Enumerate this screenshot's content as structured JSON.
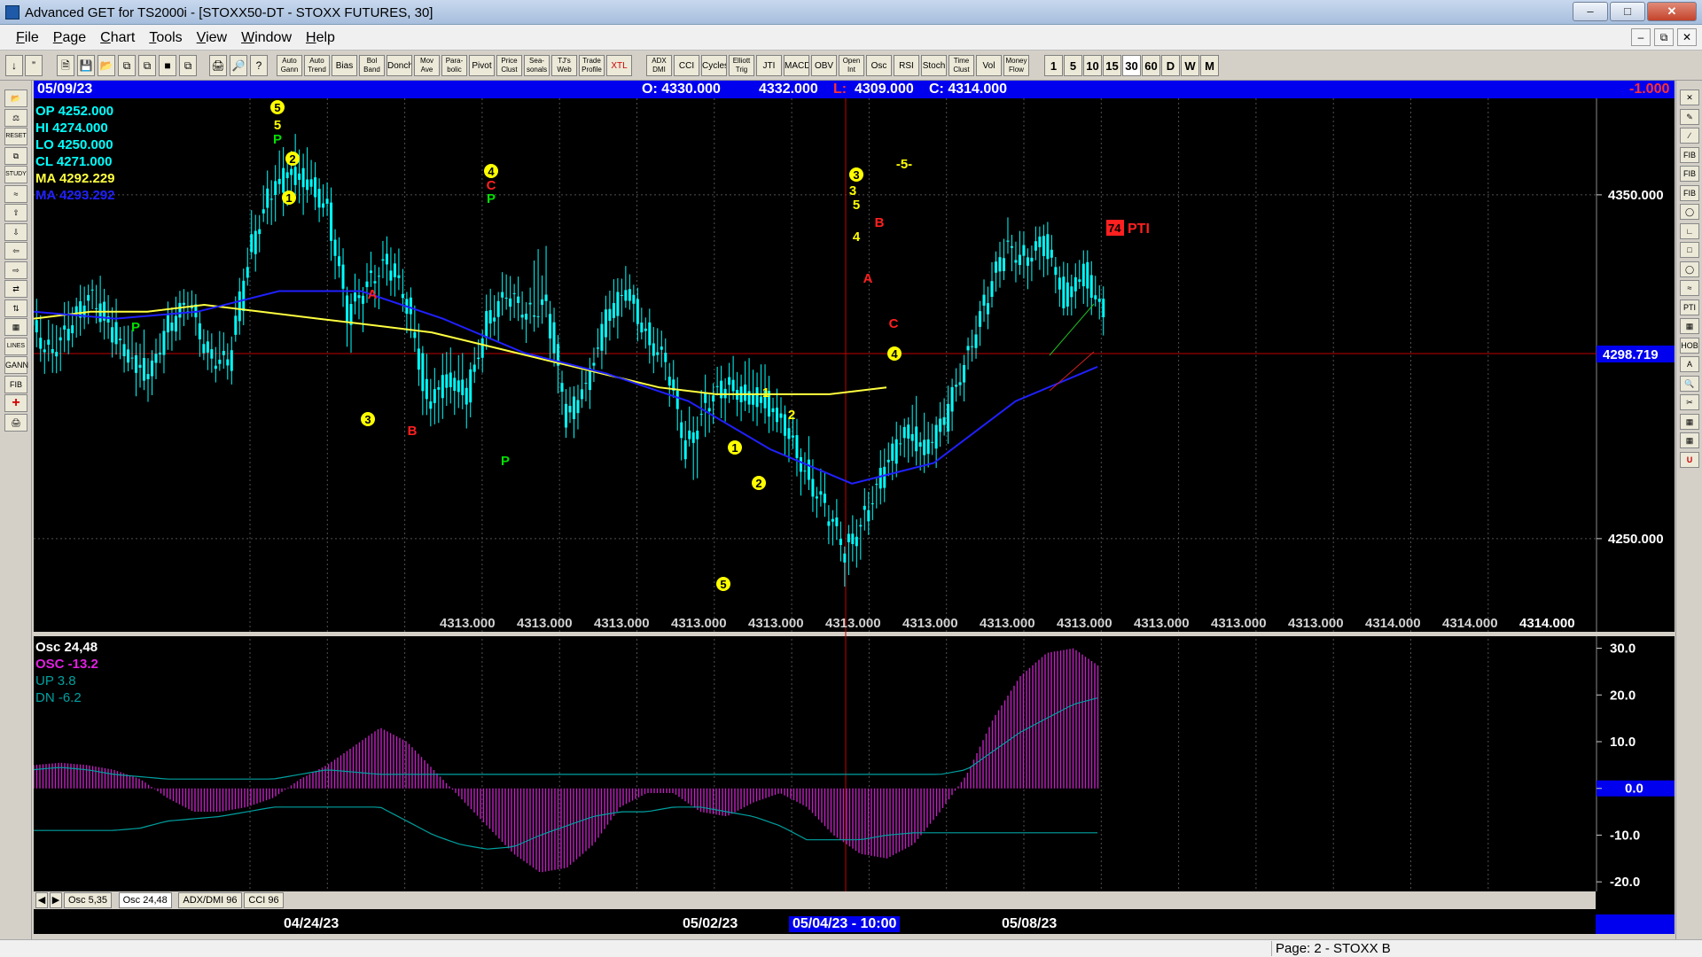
{
  "window": {
    "title": "Advanced GET for TS2000i - [STOXX50-DT - STOXX FUTURES, 30]"
  },
  "menu": [
    "File",
    "Page",
    "Chart",
    "Tools",
    "View",
    "Window",
    "Help"
  ],
  "toolbar": {
    "studies": [
      "Auto\nGann",
      "Auto\nTrend",
      "Bias",
      "Bol\nBand",
      "Donch",
      "Mov\nAve",
      "Para-\nbolic",
      "Pivot",
      "Price\nClust",
      "Sea-\nsonals",
      "TJ's\nWeb",
      "Trade\nProfile",
      "XTL",
      "ADX\nDMI",
      "CCI",
      "Cycles",
      "Elliott\nTrig",
      "JTI",
      "MACD",
      "OBV",
      "Open\nInt",
      "Osc",
      "RSI",
      "Stoch",
      "Time\nClust",
      "Vol",
      "Money\nFlow"
    ],
    "intervals": [
      "1",
      "5",
      "10",
      "15",
      "30",
      "60",
      "D",
      "W",
      "M"
    ],
    "active_interval": "30"
  },
  "infobar": {
    "date": "05/09/23",
    "open": "O: 4330.000",
    "high": "4332.000",
    "low_prefix": "L:",
    "low": "4309.000",
    "close": "C: 4314.000",
    "change": "-1.000"
  },
  "legend": {
    "op": "OP  4252.000",
    "hi": "HI   4274.000",
    "lo": "LO  4250.000",
    "cl": "CL  4271.000",
    "ma1": "MA  4292.229",
    "ma2": "MA  4293.292"
  },
  "osc_legend": {
    "title": "Osc 24,48",
    "osc": "OSC -13.2",
    "up": "UP   3.8",
    "dn": "DN   -6.2"
  },
  "pti": {
    "value": "74",
    "label": "PTI"
  },
  "price_line_label": "4298.719",
  "bottom_values": [
    "4313.000",
    "4313.000",
    "4313.000",
    "4313.000",
    "4313.000",
    "4313.000",
    "4313.000",
    "4313.000",
    "4313.000",
    "4313.000",
    "4313.000",
    "4313.000",
    "4314.000",
    "4314.000",
    "4314.000"
  ],
  "tabs": [
    "Osc 5,35",
    "Osc 24,48",
    "ADX/DMI 96",
    "CCI 96"
  ],
  "active_tab": "Osc 24,48",
  "dates": {
    "d1": "04/24/23",
    "d2": "05/02/23",
    "cursor": "05/04/23 - 10:00",
    "d3": "05/08/23"
  },
  "status": {
    "page": "Page: 2 - STOXX B"
  },
  "colors": {
    "candle": "#00ffff",
    "ma_yellow": "#ffff40",
    "ma_blue": "#2020ff",
    "osc_hist": "#c020c0",
    "osc_line": "#00a0a0",
    "wave_yellow": "#ffff00",
    "label_red": "#ff2020",
    "label_green": "#00e000",
    "cursor_line": "#c00000"
  },
  "chart_data": [
    {
      "type": "candlestick",
      "symbol": "STOXX50-DT - STOXX FUTURES",
      "interval": "30",
      "y_ticks": [
        "4350.000",
        "4250.000"
      ],
      "ylim": [
        4226,
        4376
      ],
      "ohlc_samples": [
        {
          "o": 4312,
          "h": 4318,
          "l": 4300,
          "c": 4305
        },
        {
          "o": 4305,
          "h": 4318,
          "l": 4296,
          "c": 4310
        },
        {
          "o": 4310,
          "h": 4326,
          "l": 4304,
          "c": 4322
        },
        {
          "o": 4322,
          "h": 4330,
          "l": 4308,
          "c": 4312
        },
        {
          "o": 4312,
          "h": 4318,
          "l": 4298,
          "c": 4302
        },
        {
          "o": 4302,
          "h": 4310,
          "l": 4292,
          "c": 4298
        },
        {
          "o": 4298,
          "h": 4316,
          "l": 4294,
          "c": 4312
        },
        {
          "o": 4312,
          "h": 4322,
          "l": 4306,
          "c": 4318
        },
        {
          "o": 4318,
          "h": 4320,
          "l": 4300,
          "c": 4304
        },
        {
          "o": 4304,
          "h": 4312,
          "l": 4298,
          "c": 4300
        },
        {
          "o": 4300,
          "h": 4336,
          "l": 4298,
          "c": 4332
        },
        {
          "o": 4332,
          "h": 4356,
          "l": 4328,
          "c": 4350
        },
        {
          "o": 4350,
          "h": 4364,
          "l": 4342,
          "c": 4356
        },
        {
          "o": 4356,
          "h": 4366,
          "l": 4346,
          "c": 4354
        },
        {
          "o": 4354,
          "h": 4358,
          "l": 4344,
          "c": 4346
        },
        {
          "o": 4346,
          "h": 4350,
          "l": 4308,
          "c": 4314
        },
        {
          "o": 4314,
          "h": 4330,
          "l": 4306,
          "c": 4326
        },
        {
          "o": 4326,
          "h": 4334,
          "l": 4316,
          "c": 4330
        },
        {
          "o": 4330,
          "h": 4338,
          "l": 4314,
          "c": 4318
        },
        {
          "o": 4318,
          "h": 4326,
          "l": 4284,
          "c": 4290
        },
        {
          "o": 4290,
          "h": 4302,
          "l": 4280,
          "c": 4296
        },
        {
          "o": 4296,
          "h": 4304,
          "l": 4286,
          "c": 4292
        },
        {
          "o": 4292,
          "h": 4318,
          "l": 4290,
          "c": 4314
        },
        {
          "o": 4314,
          "h": 4326,
          "l": 4308,
          "c": 4320
        },
        {
          "o": 4320,
          "h": 4326,
          "l": 4310,
          "c": 4316
        },
        {
          "o": 4316,
          "h": 4344,
          "l": 4312,
          "c": 4318
        },
        {
          "o": 4318,
          "h": 4320,
          "l": 4276,
          "c": 4284
        },
        {
          "o": 4284,
          "h": 4300,
          "l": 4280,
          "c": 4296
        },
        {
          "o": 4296,
          "h": 4318,
          "l": 4292,
          "c": 4314
        },
        {
          "o": 4314,
          "h": 4328,
          "l": 4308,
          "c": 4322
        },
        {
          "o": 4322,
          "h": 4324,
          "l": 4306,
          "c": 4310
        },
        {
          "o": 4310,
          "h": 4316,
          "l": 4296,
          "c": 4300
        },
        {
          "o": 4300,
          "h": 4304,
          "l": 4270,
          "c": 4276
        },
        {
          "o": 4276,
          "h": 4296,
          "l": 4262,
          "c": 4290
        },
        {
          "o": 4290,
          "h": 4298,
          "l": 4284,
          "c": 4294
        },
        {
          "o": 4294,
          "h": 4300,
          "l": 4288,
          "c": 4292
        },
        {
          "o": 4292,
          "h": 4302,
          "l": 4286,
          "c": 4290
        },
        {
          "o": 4290,
          "h": 4294,
          "l": 4278,
          "c": 4282
        },
        {
          "o": 4282,
          "h": 4286,
          "l": 4264,
          "c": 4270
        },
        {
          "o": 4270,
          "h": 4276,
          "l": 4254,
          "c": 4258
        },
        {
          "o": 4258,
          "h": 4262,
          "l": 4240,
          "c": 4246
        },
        {
          "o": 4246,
          "h": 4262,
          "l": 4236,
          "c": 4258
        },
        {
          "o": 4258,
          "h": 4274,
          "l": 4252,
          "c": 4270
        },
        {
          "o": 4270,
          "h": 4286,
          "l": 4266,
          "c": 4282
        },
        {
          "o": 4282,
          "h": 4292,
          "l": 4270,
          "c": 4276
        },
        {
          "o": 4276,
          "h": 4288,
          "l": 4272,
          "c": 4284
        },
        {
          "o": 4284,
          "h": 4306,
          "l": 4280,
          "c": 4302
        },
        {
          "o": 4302,
          "h": 4322,
          "l": 4298,
          "c": 4318
        },
        {
          "o": 4318,
          "h": 4338,
          "l": 4314,
          "c": 4334
        },
        {
          "o": 4334,
          "h": 4340,
          "l": 4326,
          "c": 4332
        },
        {
          "o": 4332,
          "h": 4338,
          "l": 4326,
          "c": 4336
        },
        {
          "o": 4336,
          "h": 4338,
          "l": 4316,
          "c": 4320
        },
        {
          "o": 4320,
          "h": 4332,
          "l": 4316,
          "c": 4328
        },
        {
          "o": 4328,
          "h": 4332,
          "l": 4310,
          "c": 4314
        }
      ],
      "ma_yellow_samples": [
        4314,
        4316,
        4316,
        4318,
        4316,
        4314,
        4312,
        4310,
        4306,
        4302,
        4298,
        4294,
        4292,
        4292,
        4292,
        4294
      ],
      "ma_blue_samples": [
        4316,
        4314,
        4316,
        4322,
        4322,
        4314,
        4304,
        4298,
        4290,
        4276,
        4266,
        4272,
        4290,
        4300
      ],
      "annotations": [
        {
          "text": "5",
          "style": "circle-yellow"
        },
        {
          "text": "5",
          "style": "yellow"
        },
        {
          "text": "P",
          "style": "green"
        },
        {
          "text": "2",
          "style": "circle-yellow"
        },
        {
          "text": "1",
          "style": "circle-yellow"
        },
        {
          "text": "P",
          "style": "green"
        },
        {
          "text": "A",
          "style": "red"
        },
        {
          "text": "3",
          "style": "circle-yellow"
        },
        {
          "text": "B",
          "style": "red"
        },
        {
          "text": "4",
          "style": "circle-yellow"
        },
        {
          "text": "C",
          "style": "red"
        },
        {
          "text": "P",
          "style": "green"
        },
        {
          "text": "P",
          "style": "green"
        },
        {
          "text": "1",
          "style": "circle-yellow"
        },
        {
          "text": "2",
          "style": "circle-yellow"
        },
        {
          "text": "5",
          "style": "circle-yellow"
        },
        {
          "text": "1",
          "style": "yellow"
        },
        {
          "text": "2",
          "style": "yellow"
        },
        {
          "text": "3",
          "style": "circle-yellow"
        },
        {
          "text": "3",
          "style": "yellow"
        },
        {
          "text": "5",
          "style": "yellow"
        },
        {
          "text": "4",
          "style": "yellow"
        },
        {
          "text": "B",
          "style": "red"
        },
        {
          "text": "A",
          "style": "red"
        },
        {
          "text": "C",
          "style": "red"
        },
        {
          "text": "4",
          "style": "circle-yellow"
        },
        {
          "text": "-5-",
          "style": "yellow"
        }
      ]
    },
    {
      "type": "histogram",
      "name": "Osc 24,48",
      "y_ticks": [
        "30.0",
        "20.0",
        "10.0",
        "0.0",
        "-10.0",
        "-20.0"
      ],
      "ylim": [
        -23,
        32
      ],
      "osc_samples": [
        5,
        5.5,
        5,
        4,
        2,
        -2,
        -5,
        -5,
        -4,
        -2,
        2,
        5,
        9,
        13,
        10,
        4,
        -2,
        -8,
        -14,
        -18,
        -17,
        -12,
        -4,
        -1,
        -1,
        -5,
        -6,
        -3,
        -1,
        -4,
        -10,
        -14,
        -15,
        -12,
        -5,
        3,
        15,
        24,
        29,
        30,
        26
      ],
      "osc_line_samples": [
        4,
        4.5,
        4,
        3,
        2.5,
        2,
        2,
        2,
        2,
        2,
        3,
        4,
        3.5,
        3,
        3,
        3,
        3,
        3,
        3,
        3,
        3,
        3,
        3,
        3,
        3,
        3,
        3,
        3,
        3,
        3,
        3,
        3,
        3,
        3,
        3,
        4,
        8,
        12,
        15,
        18,
        19.5
      ],
      "dn_line_samples": [
        -9,
        -9,
        -9,
        -9,
        -8.5,
        -7,
        -6.5,
        -6,
        -5,
        -4,
        -4,
        -4,
        -4,
        -4,
        -7,
        -10,
        -12,
        -13,
        -12.5,
        -10,
        -8,
        -6,
        -5,
        -5,
        -4,
        -4,
        -5,
        -6,
        -8,
        -11,
        -11,
        -11,
        -10,
        -9.5,
        -9.5,
        -9.5,
        -9.5,
        -9.5,
        -9.5,
        -9.5,
        -9.5
      ]
    }
  ]
}
